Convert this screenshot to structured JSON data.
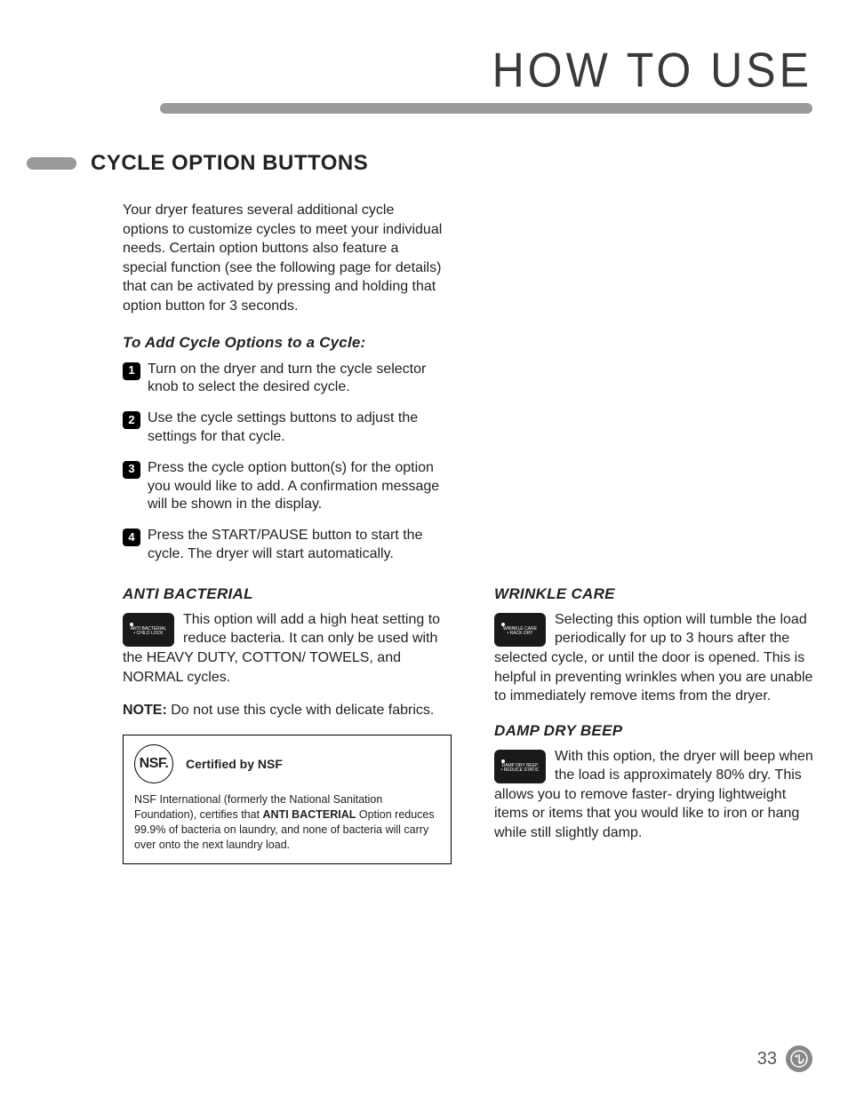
{
  "page": {
    "title": "HOW TO USE",
    "number": "33"
  },
  "section": {
    "title": "CYCLE OPTION BUTTONS",
    "intro": "Your dryer features several additional cycle options to customize cycles to meet your individual needs. Certain option buttons also feature a special function (see the following page for details) that can be activated by pressing and holding that option button for 3 seconds."
  },
  "steps": {
    "heading": "To Add Cycle Options to a Cycle:",
    "items": [
      "Turn on the dryer and turn the cycle selector knob to select the desired cycle.",
      "Use the cycle settings buttons to adjust the settings for that cycle.",
      "Press the cycle option button(s) for the option you would like to add. A confirmation message will be shown in the display.",
      "Press the START/PAUSE button to start the cycle. The dryer will start automatically."
    ]
  },
  "anti_bacterial": {
    "heading": "ANTI BACTERIAL",
    "icon_label": "ANTI BACTERIAL",
    "icon_sub": "• CHILD LOCK",
    "body": "This option will add a high heat setting to reduce bacteria. It can only be used with the HEAVY DUTY, COTTON/ TOWELS, and NORMAL cycles.",
    "note_label": "NOTE:",
    "note_body": " Do not use this cycle with delicate fabrics."
  },
  "nsf": {
    "badge": "NSF.",
    "cert": "Certified by NSF",
    "body_pre": "NSF International (formerly the National Sanitation Foundation), certifies that ",
    "body_bold": "ANTI BACTERIAL",
    "body_post": " Option reduces 99.9% of bacteria on laundry, and none of bacteria will carry over onto the next laundry load."
  },
  "wrinkle_care": {
    "heading": "WRINKLE CARE",
    "icon_label": "WRINKLE CARE",
    "icon_sub": "• RACK DRY",
    "body": "Selecting this option will tumble the load periodically for up to 3 hours after the selected cycle, or until the door is opened. This is helpful in preventing wrinkles when you are unable to immediately remove items from the dryer."
  },
  "damp_dry": {
    "heading": "DAMP DRY BEEP",
    "icon_label": "DAMP DRY BEEP",
    "icon_sub": "• REDUCE STATIC",
    "body": "With this option, the dryer will beep when the load is approximately 80% dry. This allows you to remove faster- drying lightweight items or items that you would like to iron or hang while still slightly damp."
  }
}
